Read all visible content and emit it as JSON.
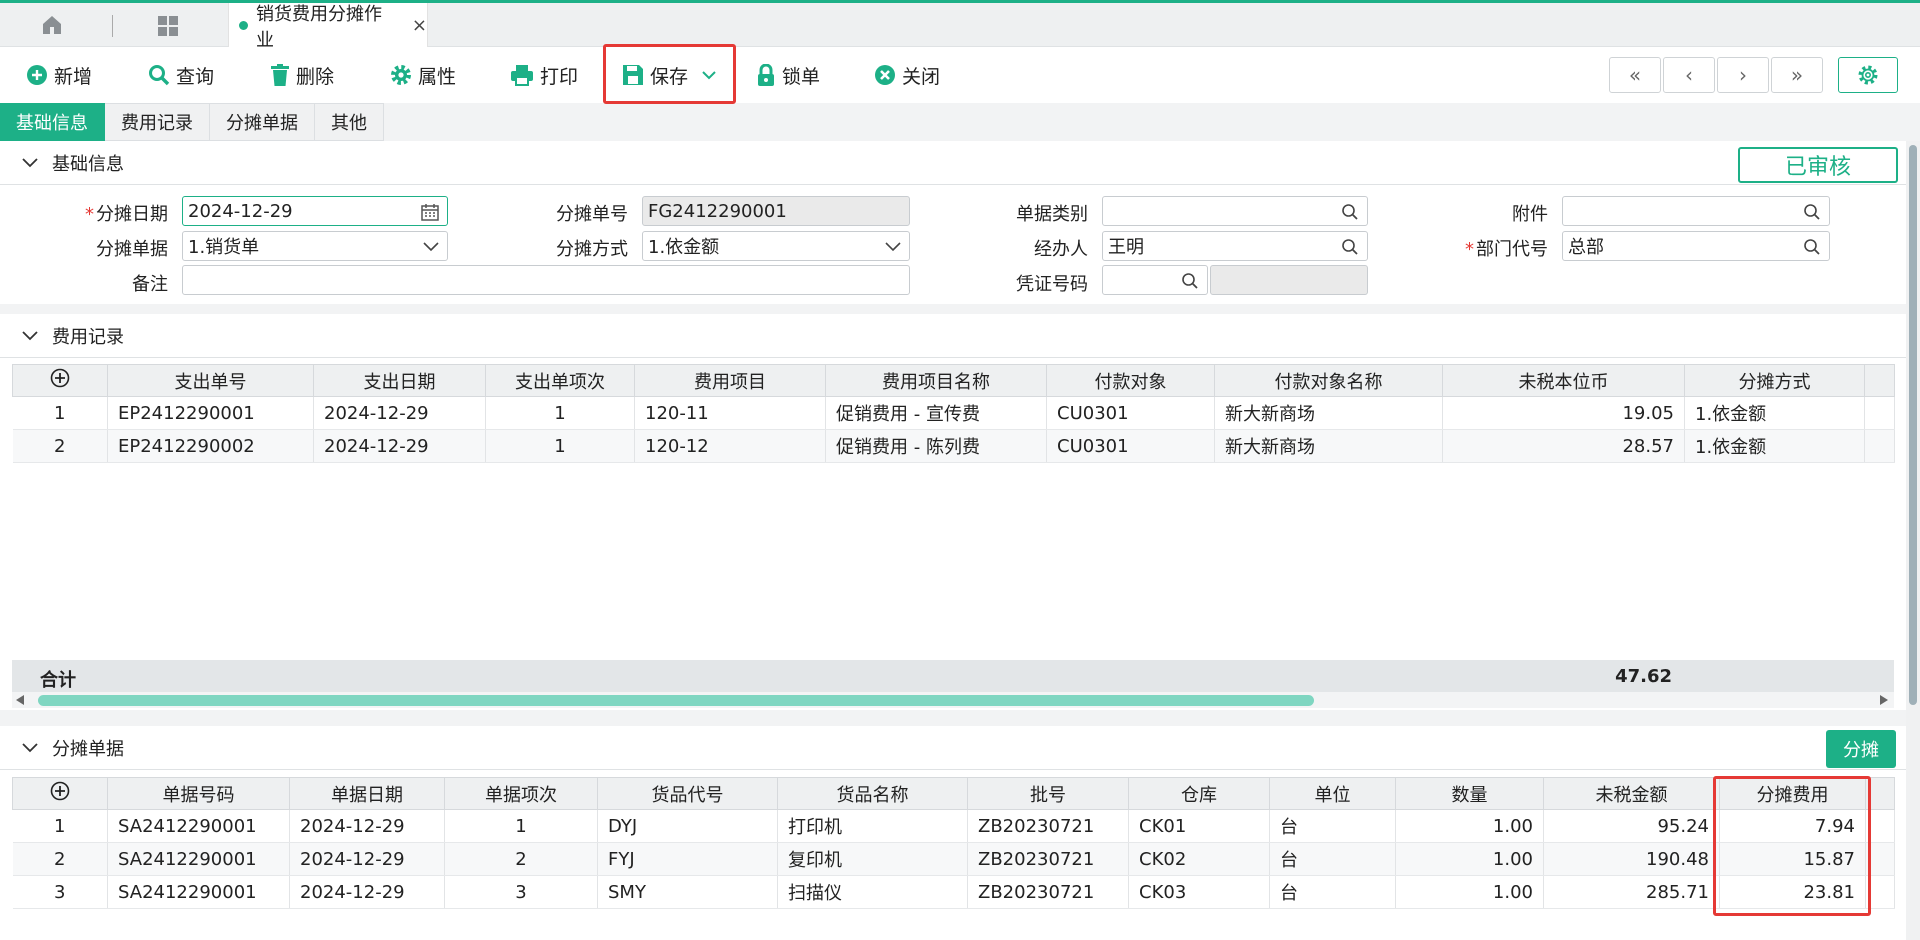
{
  "tab": {
    "title": "销货费用分摊作业",
    "close": "×"
  },
  "toolbar": {
    "add": "新增",
    "query": "查询",
    "delete": "删除",
    "properties": "属性",
    "print": "打印",
    "save": "保存",
    "lock": "锁单",
    "close": "关闭"
  },
  "nav": {
    "first": "«",
    "prev": "‹",
    "next": "›",
    "last": "»"
  },
  "section_tabs": [
    "基础信息",
    "费用记录",
    "分摊单据",
    "其他"
  ],
  "basic": {
    "title": "基础信息",
    "status": "已审核",
    "labels": {
      "date": "分摊日期",
      "no": "分摊单号",
      "doc_type": "单据类别",
      "attach": "附件",
      "source": "分摊单据",
      "method": "分摊方式",
      "handler": "经办人",
      "dept": "部门代号",
      "remark": "备注",
      "voucher": "凭证号码"
    },
    "values": {
      "date": "2024-12-29",
      "no": "FG2412290001",
      "doc_type": "",
      "attach": "",
      "source": "1.销货单",
      "method": "1.依金额",
      "handler": "王明",
      "dept": "总部",
      "remark": "",
      "voucher": "",
      "voucher2": ""
    },
    "required_mark": "*"
  },
  "expense": {
    "title": "费用记录",
    "columns": [
      "支出单号",
      "支出日期",
      "支出单项次",
      "费用项目",
      "费用项目名称",
      "付款对象",
      "付款对象名称",
      "未税本位币",
      "分摊方式"
    ],
    "rows": [
      {
        "seq": "1",
        "no": "EP2412290001",
        "date": "2024-12-29",
        "item": "1",
        "code": "120-11",
        "name": "促销费用 - 宣传费",
        "payee": "CU0301",
        "payee_name": "新大新商场",
        "amount": "19.05",
        "method": "1.依金额"
      },
      {
        "seq": "2",
        "no": "EP2412290002",
        "date": "2024-12-29",
        "item": "1",
        "code": "120-12",
        "name": "促销费用 - 陈列费",
        "payee": "CU0301",
        "payee_name": "新大新商场",
        "amount": "28.57",
        "method": "1.依金额"
      }
    ],
    "total_label": "合计",
    "total": "47.62"
  },
  "alloc": {
    "title": "分摊单据",
    "button": "分摊",
    "columns": [
      "单据号码",
      "单据日期",
      "单据项次",
      "货品代号",
      "货品名称",
      "批号",
      "仓库",
      "单位",
      "数量",
      "未税金额",
      "分摊费用"
    ],
    "rows": [
      {
        "seq": "1",
        "no": "SA2412290001",
        "date": "2024-12-29",
        "item": "1",
        "code": "DYJ",
        "name": "打印机",
        "batch": "ZB20230721",
        "wh": "CK01",
        "unit": "台",
        "qty": "1.00",
        "amount": "95.24",
        "fee": "7.94"
      },
      {
        "seq": "2",
        "no": "SA2412290001",
        "date": "2024-12-29",
        "item": "2",
        "code": "FYJ",
        "name": "复印机",
        "batch": "ZB20230721",
        "wh": "CK02",
        "unit": "台",
        "qty": "1.00",
        "amount": "190.48",
        "fee": "15.87"
      },
      {
        "seq": "3",
        "no": "SA2412290001",
        "date": "2024-12-29",
        "item": "3",
        "code": "SMY",
        "name": "扫描仪",
        "batch": "ZB20230721",
        "wh": "CK03",
        "unit": "台",
        "qty": "1.00",
        "amount": "285.71",
        "fee": "23.81"
      }
    ]
  },
  "colors": {
    "accent": "#1db087",
    "highlight": "#e53935"
  }
}
